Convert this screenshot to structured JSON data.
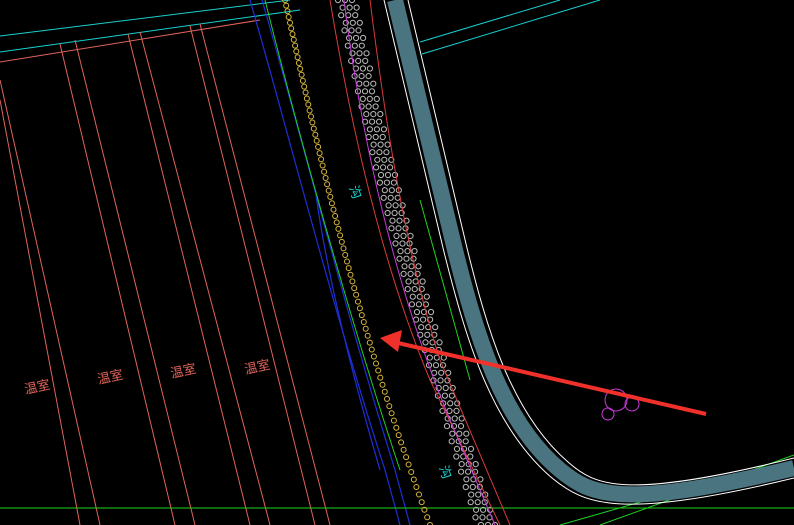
{
  "drawing": {
    "background": "#000000",
    "labels": {
      "greenhouse": "温室",
      "ditch": "沟"
    },
    "colors": {
      "greenhouse_lines": "#e0645a",
      "road": "#4a7480",
      "road_edge": "#ffffff",
      "cyan_lines": "#18d0d0",
      "blue_lines": "#1f2fd8",
      "green_lines": "#1fd31f",
      "yellow_chain": "#d8b83c",
      "red_hatch": "#d93b3b",
      "hatch_circles": "#c0c0c0",
      "magenta_tree": "#c83ad8",
      "arrow": "#f0302a"
    }
  }
}
